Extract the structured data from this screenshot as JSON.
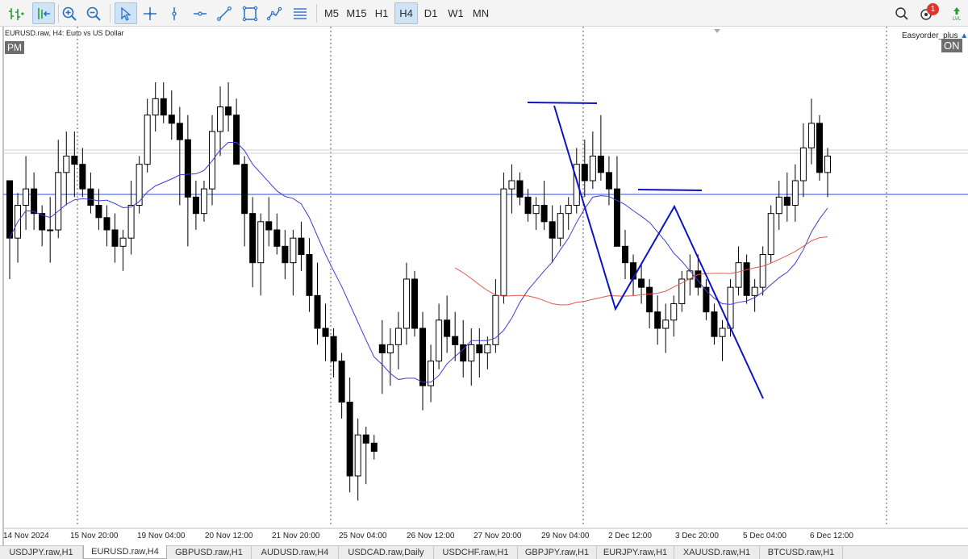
{
  "toolbar": {
    "tools": [
      {
        "name": "chart-bars-icon"
      },
      {
        "name": "autoscroll-icon"
      },
      {
        "name": "zoom-in-icon"
      },
      {
        "name": "zoom-out-icon"
      },
      {
        "name": "cursor-icon"
      },
      {
        "name": "crosshair-icon"
      },
      {
        "name": "vertical-line-icon"
      },
      {
        "name": "horizontal-line-icon"
      },
      {
        "name": "trend-line-icon"
      },
      {
        "name": "rectangle-icon"
      },
      {
        "name": "polyline-icon"
      },
      {
        "name": "fibonacci-icon"
      }
    ],
    "timeframes": [
      "M5",
      "M15",
      "H1",
      "H4",
      "D1",
      "W1",
      "MN"
    ],
    "active_timeframe": "H4",
    "search_icon": "search-icon",
    "notifications_icon": "notifications-icon",
    "notification_count": "1",
    "level_icon": "signal-level-icon"
  },
  "chart": {
    "symbol_title": "EURUSD.raw, H4:  Euro vs US Dollar",
    "session_label": "PM",
    "ea_name": "Easyorder_plus",
    "ea_icon": "hat-icon",
    "ea_status": "ON",
    "colors": {
      "ma_fast": "#3d3dd6",
      "ma_slow": "#e05a4a",
      "hline": "#5a6cf0",
      "drawing": "#0a14c4",
      "grid": "#555555"
    }
  },
  "chart_data": {
    "type": "candlestick",
    "x_labels": [
      "14 Nov 2024",
      "15 Nov 20:00",
      "19 Nov 04:00",
      "20 Nov 12:00",
      "21 Nov 20:00",
      "25 Nov 04:00",
      "26 Nov 12:00",
      "27 Nov 20:00",
      "29 Nov 04:00",
      "2 Dec 12:00",
      "3 Dec 20:00",
      "5 Dec 04:00",
      "6 Dec 12:00"
    ],
    "ohlc": [
      [
        1.062,
        1.058,
        1.05,
        1.055
      ],
      [
        1.055,
        1.0605,
        1.052,
        1.059
      ],
      [
        1.059,
        1.065,
        1.056,
        1.061
      ],
      [
        1.061,
        1.063,
        1.056,
        1.058
      ],
      [
        1.058,
        1.059,
        1.054,
        1.056
      ],
      [
        1.056,
        1.06,
        1.052,
        1.056
      ],
      [
        1.056,
        1.067,
        1.055,
        1.063
      ],
      [
        1.063,
        1.068,
        1.059,
        1.065
      ],
      [
        1.065,
        1.068,
        1.06,
        1.064
      ],
      [
        1.064,
        1.066,
        1.06,
        1.061
      ],
      [
        1.061,
        1.063,
        1.058,
        1.059
      ],
      [
        1.059,
        1.061,
        1.056,
        1.0575
      ],
      [
        1.0575,
        1.059,
        1.054,
        1.056
      ],
      [
        1.056,
        1.058,
        1.052,
        1.054
      ],
      [
        1.054,
        1.056,
        1.051,
        1.055
      ],
      [
        1.055,
        1.062,
        1.053,
        1.059
      ],
      [
        1.059,
        1.065,
        1.058,
        1.064
      ],
      [
        1.064,
        1.072,
        1.063,
        1.07
      ],
      [
        1.07,
        1.074,
        1.068,
        1.072
      ],
      [
        1.072,
        1.074,
        1.069,
        1.07
      ],
      [
        1.07,
        1.073,
        1.067,
        1.069
      ],
      [
        1.069,
        1.071,
        1.059,
        1.067
      ],
      [
        1.067,
        1.07,
        1.054,
        1.06
      ],
      [
        1.06,
        1.062,
        1.056,
        1.058
      ],
      [
        1.058,
        1.062,
        1.057,
        1.061
      ],
      [
        1.061,
        1.07,
        1.059,
        1.068
      ],
      [
        1.068,
        1.0735,
        1.065,
        1.071
      ],
      [
        1.071,
        1.074,
        1.068,
        1.07
      ],
      [
        1.07,
        1.072,
        1.064,
        1.064
      ],
      [
        1.064,
        1.065,
        1.054,
        1.058
      ],
      [
        1.058,
        1.06,
        1.049,
        1.052
      ],
      [
        1.052,
        1.058,
        1.048,
        1.057
      ],
      [
        1.057,
        1.06,
        1.054,
        1.056
      ],
      [
        1.056,
        1.058,
        1.053,
        1.054
      ],
      [
        1.054,
        1.056,
        1.05,
        1.052
      ],
      [
        1.052,
        1.056,
        1.048,
        1.055
      ],
      [
        1.055,
        1.057,
        1.051,
        1.053
      ],
      [
        1.053,
        1.055,
        1.046,
        1.048
      ],
      [
        1.048,
        1.052,
        1.042,
        1.044
      ],
      [
        1.044,
        1.047,
        1.04,
        1.043
      ],
      [
        1.043,
        1.044,
        1.038,
        1.04
      ],
      [
        1.04,
        1.041,
        1.033,
        1.035
      ],
      [
        1.035,
        1.038,
        1.024,
        1.026
      ],
      [
        1.026,
        1.033,
        1.023,
        1.031
      ],
      [
        1.031,
        1.032,
        1.025,
        1.03
      ],
      [
        1.03,
        1.031,
        1.028,
        1.029
      ],
      [
        1.042,
        1.045,
        1.036,
        1.041
      ],
      [
        1.041,
        1.044,
        1.037,
        1.042
      ],
      [
        1.042,
        1.046,
        1.039,
        1.044
      ],
      [
        1.044,
        1.052,
        1.042,
        1.05
      ],
      [
        1.05,
        1.051,
        1.043,
        1.044
      ],
      [
        1.044,
        1.046,
        1.034,
        1.037
      ],
      [
        1.037,
        1.042,
        1.035,
        1.04
      ],
      [
        1.04,
        1.047,
        1.039,
        1.045
      ],
      [
        1.045,
        1.048,
        1.041,
        1.043
      ],
      [
        1.043,
        1.046,
        1.04,
        1.042
      ],
      [
        1.042,
        1.045,
        1.038,
        1.04
      ],
      [
        1.04,
        1.044,
        1.037,
        1.042
      ],
      [
        1.042,
        1.044,
        1.038,
        1.041
      ],
      [
        1.041,
        1.043,
        1.039,
        1.042
      ],
      [
        1.042,
        1.05,
        1.041,
        1.048
      ],
      [
        1.048,
        1.063,
        1.047,
        1.061
      ],
      [
        1.061,
        1.064,
        1.058,
        1.062
      ],
      [
        1.062,
        1.063,
        1.059,
        1.06
      ],
      [
        1.06,
        1.061,
        1.057,
        1.058
      ],
      [
        1.058,
        1.06,
        1.056,
        1.059
      ],
      [
        1.059,
        1.062,
        1.056,
        1.057
      ],
      [
        1.057,
        1.059,
        1.052,
        1.055
      ],
      [
        1.055,
        1.059,
        1.054,
        1.058
      ],
      [
        1.058,
        1.06,
        1.056,
        1.059
      ],
      [
        1.059,
        1.066,
        1.058,
        1.064
      ],
      [
        1.064,
        1.067,
        1.06,
        1.062
      ],
      [
        1.062,
        1.068,
        1.061,
        1.065
      ],
      [
        1.065,
        1.07,
        1.062,
        1.063
      ],
      [
        1.063,
        1.065,
        1.059,
        1.061
      ],
      [
        1.061,
        1.065,
        1.056,
        1.054
      ],
      [
        1.054,
        1.056,
        1.05,
        1.052
      ],
      [
        1.052,
        1.053,
        1.048,
        1.05
      ],
      [
        1.05,
        1.052,
        1.047,
        1.049
      ],
      [
        1.049,
        1.05,
        1.044,
        1.046
      ],
      [
        1.046,
        1.048,
        1.042,
        1.044
      ],
      [
        1.044,
        1.047,
        1.041,
        1.045
      ],
      [
        1.045,
        1.048,
        1.043,
        1.047
      ],
      [
        1.047,
        1.051,
        1.046,
        1.05
      ],
      [
        1.05,
        1.053,
        1.048,
        1.051
      ],
      [
        1.051,
        1.053,
        1.048,
        1.049
      ],
      [
        1.049,
        1.05,
        1.045,
        1.046
      ],
      [
        1.046,
        1.047,
        1.042,
        1.043
      ],
      [
        1.043,
        1.045,
        1.04,
        1.044
      ],
      [
        1.044,
        1.05,
        1.043,
        1.049
      ],
      [
        1.049,
        1.054,
        1.048,
        1.052
      ],
      [
        1.052,
        1.053,
        1.047,
        1.048
      ],
      [
        1.048,
        1.05,
        1.046,
        1.049
      ],
      [
        1.049,
        1.054,
        1.048,
        1.053
      ],
      [
        1.053,
        1.059,
        1.052,
        1.058
      ],
      [
        1.058,
        1.062,
        1.056,
        1.06
      ],
      [
        1.06,
        1.063,
        1.057,
        1.059
      ],
      [
        1.059,
        1.064,
        1.057,
        1.062
      ],
      [
        1.062,
        1.069,
        1.06,
        1.066
      ],
      [
        1.066,
        1.072,
        1.064,
        1.069
      ],
      [
        1.069,
        1.07,
        1.062,
        1.063
      ],
      [
        1.063,
        1.066,
        1.06,
        1.065
      ]
    ],
    "ma_fast_note": "blue moving average overlay",
    "ma_slow_note": "red moving average overlay",
    "y_range": [
      1.02,
      1.08
    ],
    "grid": true
  },
  "tabs": [
    {
      "label": "USDJPY.raw,H1"
    },
    {
      "label": "EURUSD.raw,H4"
    },
    {
      "label": "GBPUSD.raw,H1"
    },
    {
      "label": "AUDUSD.raw,H4"
    },
    {
      "label": "USDCAD.raw,Daily"
    },
    {
      "label": "USDCHF.raw,H1"
    },
    {
      "label": "GBPJPY.raw,H1"
    },
    {
      "label": "EURJPY.raw,H1"
    },
    {
      "label": "XAUUSD.raw,H1"
    },
    {
      "label": "BTCUSD.raw,H1"
    }
  ],
  "active_tab": "EURUSD.raw,H4"
}
